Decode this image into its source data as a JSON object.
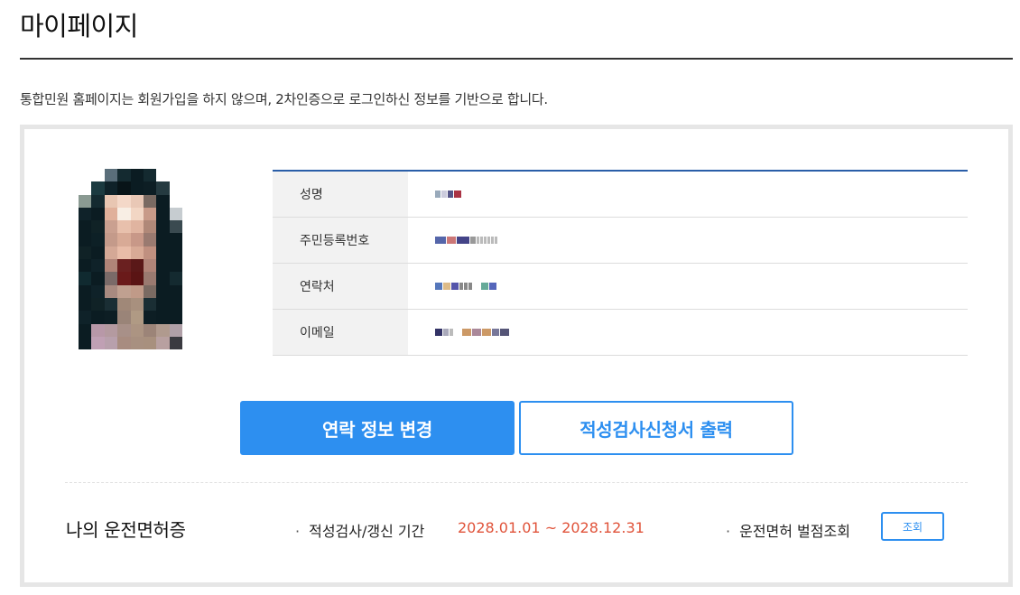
{
  "page": {
    "title": "마이페이지",
    "notice": "통합민원 홈페이지는 회원가입을 하지 않으며, 2차인증으로 로그인하신 정보를 기반으로 합니다."
  },
  "profile": {
    "rows": [
      {
        "label": "성명",
        "value_blurred": true
      },
      {
        "label": "주민등록번호",
        "value_blurred": true
      },
      {
        "label": "연락처",
        "value_blurred": true
      },
      {
        "label": "이메일",
        "value_blurred": true
      }
    ]
  },
  "actions": {
    "change_contact": "연락 정보 변경",
    "print_application": "적성검사신청서 출력"
  },
  "license": {
    "title": "나의 운전면허증",
    "period_label": "적성검사/갱신 기간",
    "period_value": "2028.01.01 ~ 2028.12.31",
    "penalty_label": "운전면허 벌점조회",
    "query_button": "조회"
  },
  "colors": {
    "accent": "#2d8ff0",
    "table_top_border": "#2a5ea8",
    "period_text": "#e0533a"
  }
}
